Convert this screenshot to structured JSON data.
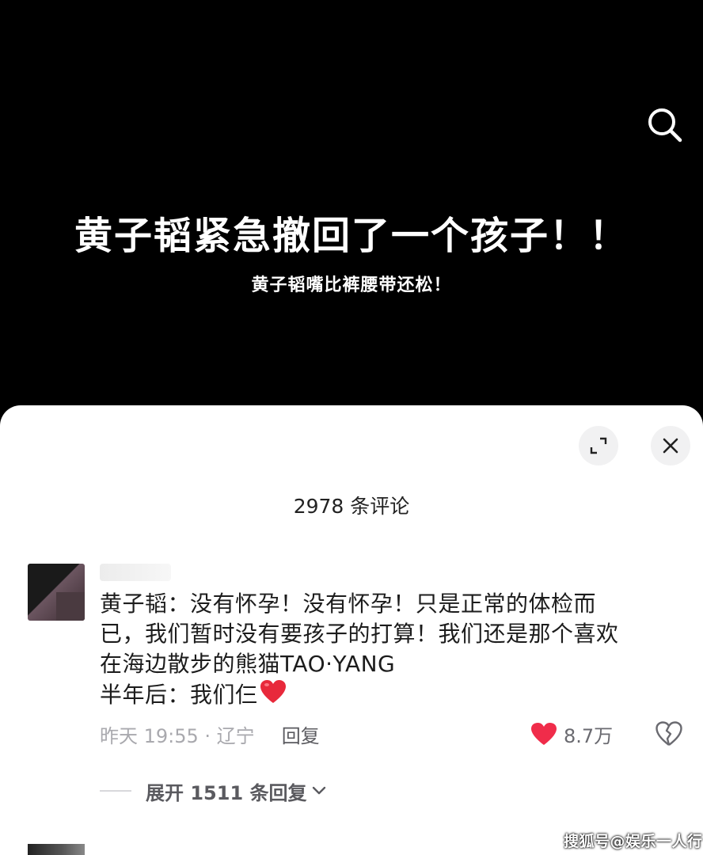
{
  "video": {
    "headline": "黄子韬紧急撤回了一个孩子！！",
    "subline": "黄子韬嘴比裤腰带还松！"
  },
  "comments_panel": {
    "count_label": "2978 条评论"
  },
  "comment": {
    "lines": [
      "黄子韬：没有怀孕！没有怀孕！只是正常的体检而",
      "已，我们暂时没有要孩子的打算！我们还是那个喜欢",
      "在海边散步的熊猫TAO·YANG",
      "半年后：我们仨"
    ],
    "time_location": "昨天 19:55 · 辽宁",
    "reply_label": "回复",
    "like_count": "8.7万",
    "expand_label": "展开 1511 条回复"
  },
  "watermark": "搜狐号@娱乐一人行",
  "colors": {
    "like_red": "#f02c4a",
    "sheet_bg": "#ffffff",
    "video_bg": "#000000"
  },
  "icons": [
    "search-icon",
    "expand-icon",
    "close-icon",
    "heart-icon",
    "broken-heart-icon",
    "chevron-down-icon"
  ]
}
